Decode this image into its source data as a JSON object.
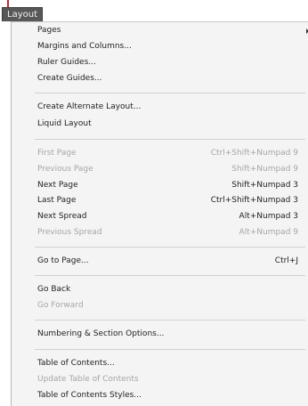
{
  "menubar": {
    "title": "Layout"
  },
  "menu": {
    "items": [
      {
        "label": "Pages",
        "shortcut": ""
      },
      {
        "label": "Margins and Columns...",
        "shortcut": ""
      },
      {
        "label": "Ruler Guides...",
        "shortcut": ""
      },
      {
        "label": "Create Guides...",
        "shortcut": ""
      },
      {
        "label": "Create Alternate Layout...",
        "shortcut": ""
      },
      {
        "label": "Liquid Layout",
        "shortcut": ""
      },
      {
        "label": "First Page",
        "shortcut": "Ctrl+Shift+Numpad 9"
      },
      {
        "label": "Previous Page",
        "shortcut": "Shift+Numpad 9"
      },
      {
        "label": "Next Page",
        "shortcut": "Shift+Numpad 3"
      },
      {
        "label": "Last Page",
        "shortcut": "Ctrl+Shift+Numpad 3"
      },
      {
        "label": "Next Spread",
        "shortcut": "Alt+Numpad 3"
      },
      {
        "label": "Previous Spread",
        "shortcut": "Alt+Numpad 9"
      },
      {
        "label": "Go to Page...",
        "shortcut": "Ctrl+J"
      },
      {
        "label": "Go Back",
        "shortcut": ""
      },
      {
        "label": "Go Forward",
        "shortcut": ""
      },
      {
        "label": "Numbering & Section Options...",
        "shortcut": ""
      },
      {
        "label": "Table of Contents...",
        "shortcut": ""
      },
      {
        "label": "Update Table of Contents",
        "shortcut": ""
      },
      {
        "label": "Table of Contents Styles...",
        "shortcut": ""
      }
    ]
  }
}
